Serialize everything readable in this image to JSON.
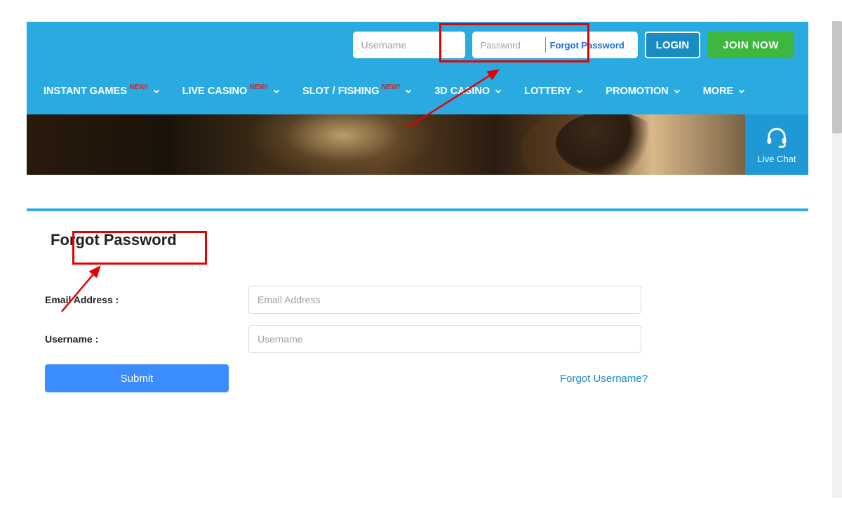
{
  "topbar": {
    "username_placeholder": "Username",
    "password_placeholder": "Password",
    "forgot_link": "Forgot Password",
    "login_label": "LOGIN",
    "join_label": "JOIN NOW"
  },
  "nav": {
    "items": [
      {
        "label": "INSTANT GAMES",
        "badge": "NEW!"
      },
      {
        "label": "LIVE CASINO",
        "badge": "NEW!"
      },
      {
        "label": "SLOT / FISHING",
        "badge": "NEW!"
      },
      {
        "label": "3D CASINO",
        "badge": ""
      },
      {
        "label": "LOTTERY",
        "badge": ""
      },
      {
        "label": "PROMOTION",
        "badge": ""
      },
      {
        "label": "MORE",
        "badge": ""
      }
    ]
  },
  "livechat_label": "Live Chat",
  "page": {
    "heading": "Forgot Password",
    "email_label": "Email Address :",
    "email_placeholder": "Email Address",
    "username_label": "Username :",
    "username_placeholder": "Username",
    "submit_label": "Submit",
    "forgot_username_link": "Forgot Username?"
  }
}
